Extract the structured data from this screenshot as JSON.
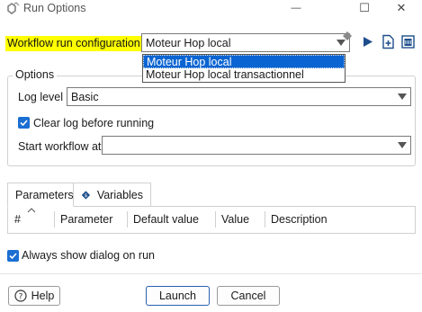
{
  "window": {
    "title": "Run Options",
    "minimize_glyph": "—",
    "maximize_glyph": "☐",
    "close_glyph": "✕"
  },
  "workflow": {
    "label": "Workflow run configuration",
    "selected": "Moteur Hop local",
    "options": [
      "Moteur Hop local",
      "Moteur Hop local transactionnel"
    ]
  },
  "options": {
    "legend": "Options",
    "log_level_label": "Log level",
    "log_level_value": "Basic",
    "clear_log_label": "Clear log before running",
    "clear_log_checked": true,
    "start_label": "Start workflow at",
    "start_value": ""
  },
  "tabs": {
    "parameters": "Parameters",
    "variables": "Variables"
  },
  "table": {
    "columns": [
      "#",
      "Parameter",
      "Default value",
      "Value",
      "Description"
    ]
  },
  "always_show": {
    "label": "Always show dialog on run",
    "checked": true
  },
  "buttons": {
    "help": "Help",
    "launch": "Launch",
    "cancel": "Cancel"
  },
  "icons": {
    "app": "pipeline-icon",
    "run": "play-icon",
    "new": "new-file-icon",
    "manage": "manage-icon"
  },
  "colors": {
    "highlight": "#ffff00",
    "selection": "#0a64d2",
    "checkbox": "#1b6ed2",
    "run_icon": "#1e4e8c"
  }
}
